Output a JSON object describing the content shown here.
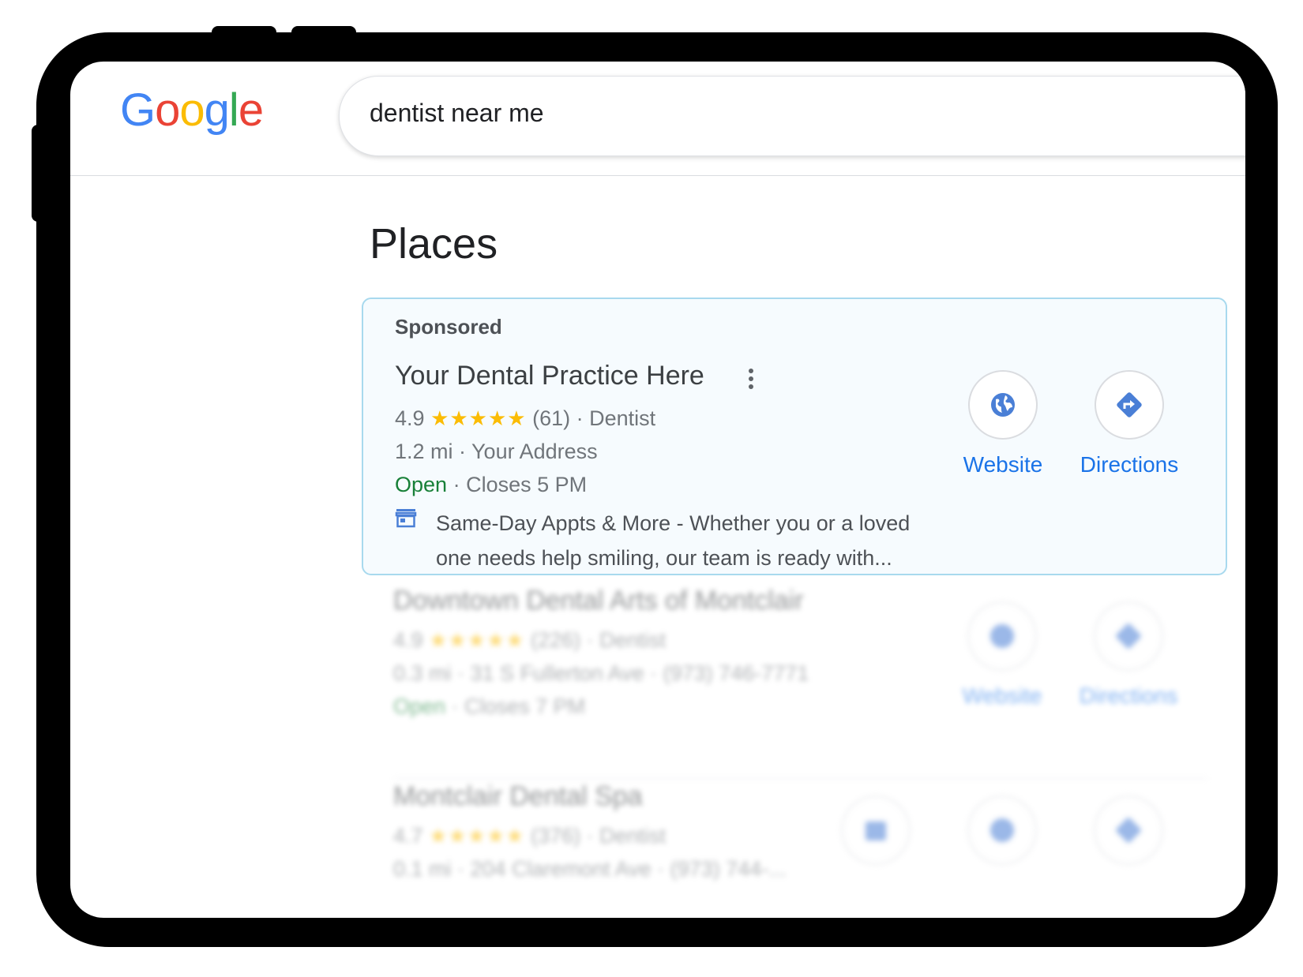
{
  "search": {
    "query": "dentist near me"
  },
  "logo": {
    "letters": [
      "G",
      "o",
      "o",
      "g",
      "l",
      "e"
    ],
    "colors": [
      "#4285F4",
      "#EA4335",
      "#FBBC05",
      "#4285F4",
      "#34A853",
      "#EA4335"
    ]
  },
  "places": {
    "title": "Places",
    "sponsored_card": {
      "sponsored_label": "Sponsored",
      "name": "Your Dental Practice Here",
      "rating": "4.9",
      "stars": "★★★★★",
      "reviews": "(61)",
      "category": "· Dentist",
      "distance_address": "1.2 mi · Your Address",
      "open_status": "Open",
      "hours": "· Closes 5 PM",
      "description": "Same-Day Appts & More - Whether you or a loved one needs help smiling, our team is ready with...",
      "actions": {
        "website": "Website",
        "directions": "Directions"
      },
      "icons": [
        "globe-icon",
        "directions-icon",
        "storefront-icon",
        "more-vert-icon"
      ]
    },
    "results": [
      {
        "name": "Downtown Dental Arts of Montclair",
        "rating": "4.9",
        "stars": "★★★★★",
        "reviews": "(226) · Dentist",
        "address": "0.3 mi · 31 S Fullerton Ave · (973) 746-7771",
        "open_status": "Open",
        "hours": "· Closes 7 PM",
        "website": "Website",
        "directions": "Directions"
      },
      {
        "name": "Montclair Dental Spa",
        "rating": "4.7",
        "stars": "★★★★★",
        "reviews": "(376) · Dentist",
        "address": "0.1 mi · 204 Claremont Ave · (973) 744-..."
      }
    ]
  },
  "colors": {
    "accent_blue": "#1a73e8",
    "star_yellow": "#fbbc04",
    "open_green": "#188038",
    "card_border": "#a8d9ee"
  }
}
